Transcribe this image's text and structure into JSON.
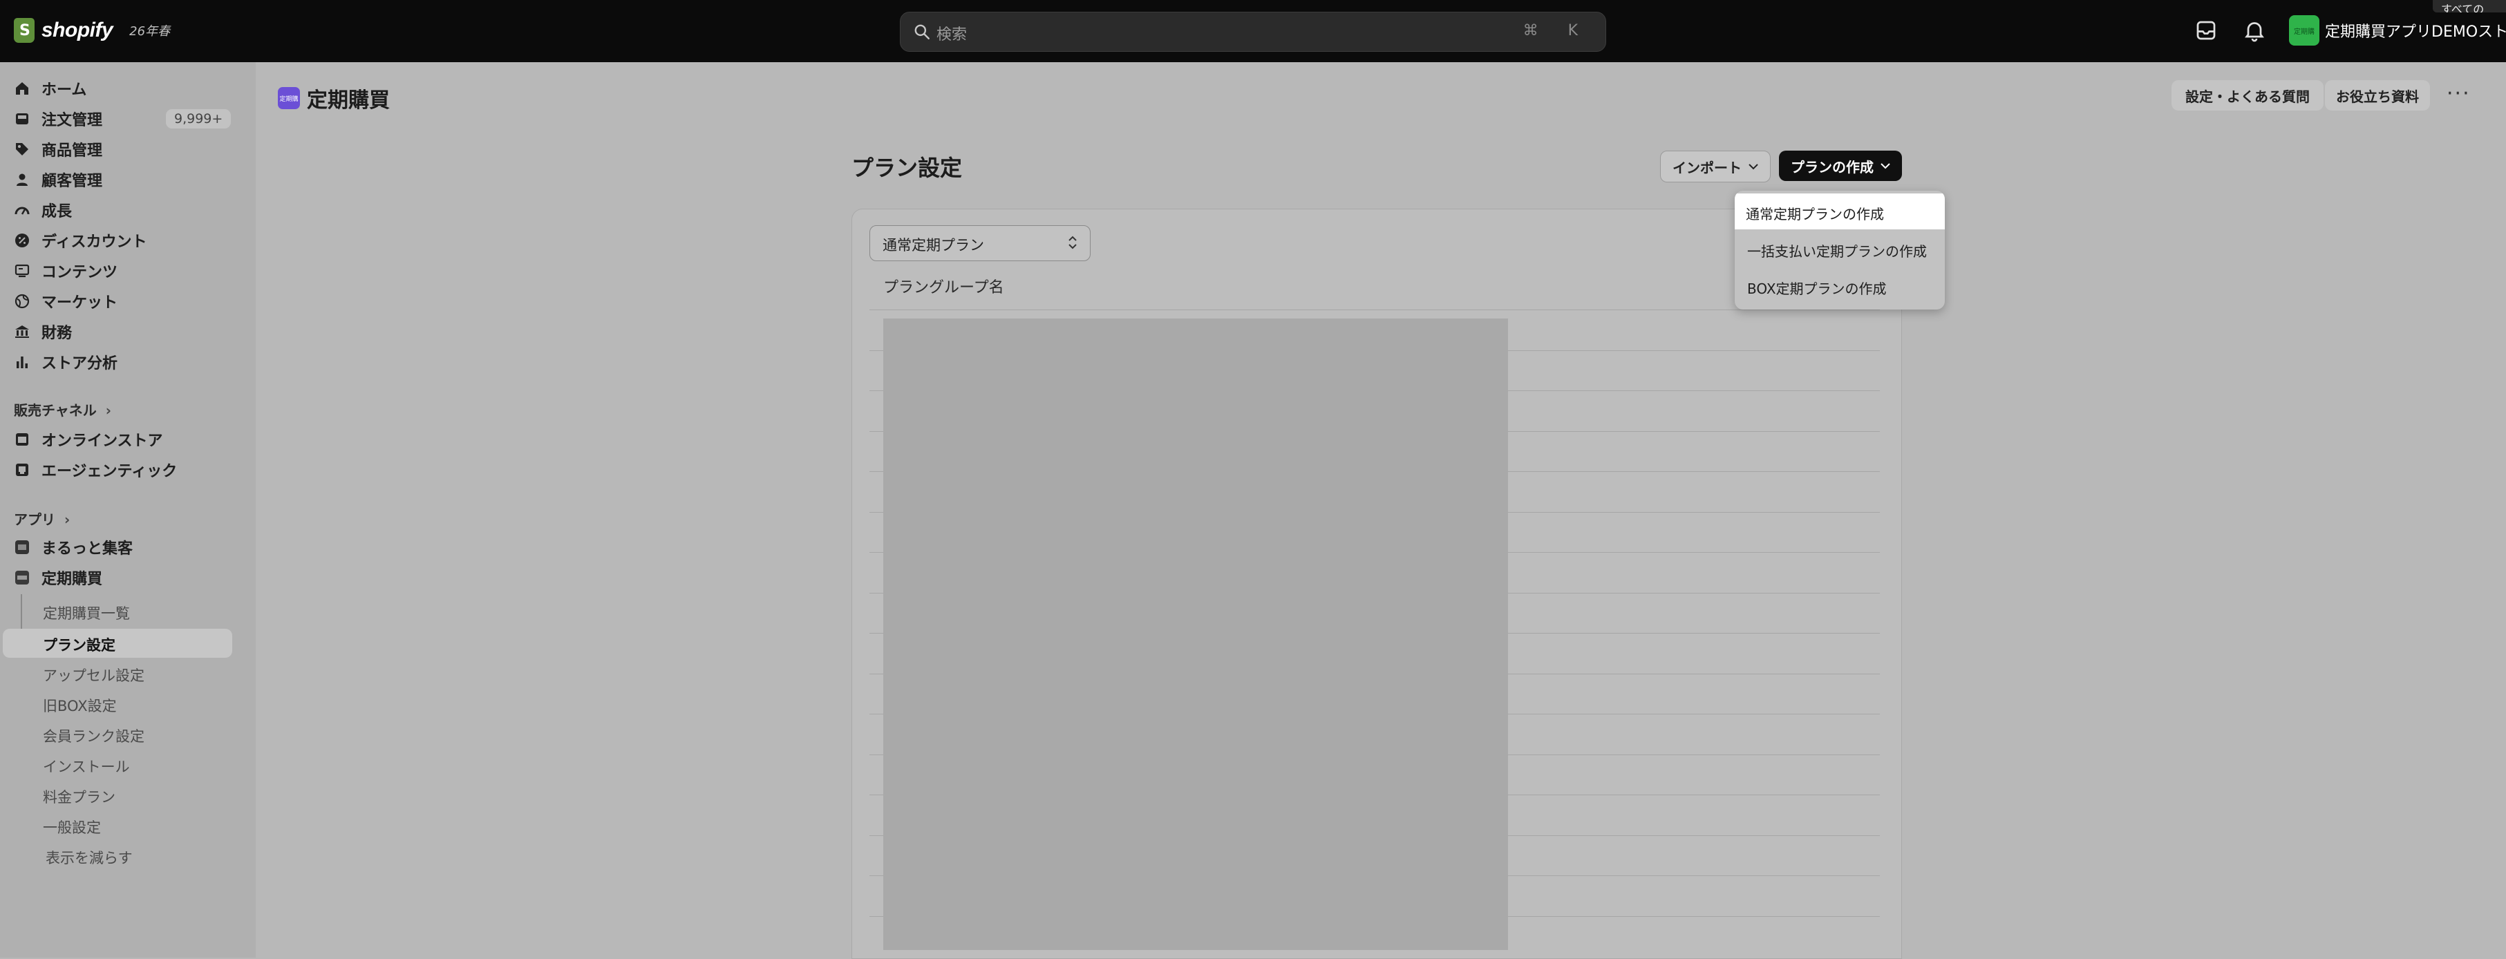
{
  "topbar": {
    "brand": "shopify",
    "edition": "26年春",
    "search_placeholder": "検索",
    "search_shortcut": "⌘ K",
    "store_name": "定期購買アプリDEMOストア",
    "store_avatar_label": "定期購",
    "corner_tip": "すべての"
  },
  "sidebar": {
    "main_items": [
      {
        "label": "ホーム",
        "icon": "home-icon"
      },
      {
        "label": "注文管理",
        "icon": "inbox-icon",
        "badge": "9,999+"
      },
      {
        "label": "商品管理",
        "icon": "tag-icon"
      },
      {
        "label": "顧客管理",
        "icon": "person-icon"
      },
      {
        "label": "成長",
        "icon": "gauge-icon"
      },
      {
        "label": "ディスカウント",
        "icon": "discount-icon"
      },
      {
        "label": "コンテンツ",
        "icon": "content-icon"
      },
      {
        "label": "マーケット",
        "icon": "globe-icon"
      },
      {
        "label": "財務",
        "icon": "bank-icon"
      },
      {
        "label": "ストア分析",
        "icon": "chart-icon"
      }
    ],
    "sales_channel_label": "販売チャネル",
    "sales_channels": [
      {
        "label": "オンラインストア",
        "icon": "store-icon"
      },
      {
        "label": "エージェンティック",
        "icon": "agent-icon"
      }
    ],
    "apps_label": "アプリ",
    "apps": [
      {
        "label": "まるっと集客",
        "icon": "app-marutto-icon"
      },
      {
        "label": "定期購買",
        "icon": "app-teiki-icon"
      }
    ],
    "sub_items": [
      {
        "label": "定期購買一覧"
      },
      {
        "label": "プラン設定",
        "active": true
      },
      {
        "label": "アップセル設定"
      },
      {
        "label": "旧BOX設定"
      },
      {
        "label": "会員ランク設定"
      },
      {
        "label": "インストール"
      },
      {
        "label": "料金プラン"
      },
      {
        "label": "一般設定"
      },
      {
        "label": "表示を減らす"
      }
    ]
  },
  "header": {
    "app_title": "定期購買",
    "app_icon_label": "定期購",
    "settings_faq": "設定・よくある質問",
    "resources": "お役立ち資料"
  },
  "main": {
    "page_title": "プラン設定",
    "import_label": "インポート",
    "create_label": "プランの作成",
    "select_value": "通常定期プラン",
    "column_header": "プラングループ名"
  },
  "dropdown": {
    "items": [
      {
        "label": "通常定期プランの作成",
        "active": true
      },
      {
        "label": "一括支払い定期プランの作成"
      },
      {
        "label": "BOX定期プランの作成"
      }
    ]
  },
  "colors": {
    "topbar": "#0b0b0b",
    "overlay_bg": "#b8b8b8",
    "store_avatar": "#2fb34a",
    "app_icon": "#6b4fd6"
  }
}
